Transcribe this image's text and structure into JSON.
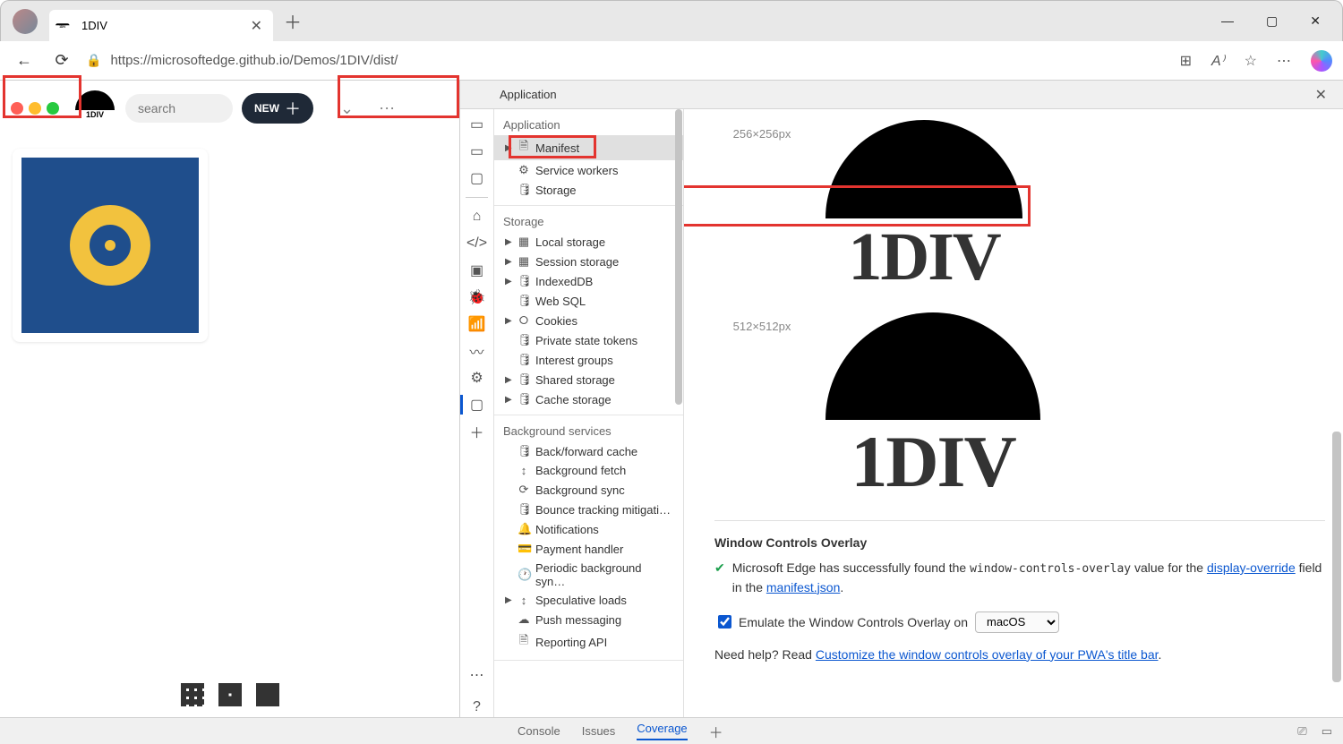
{
  "browser": {
    "tab_title": "1DIV",
    "url": "https://microsoftedge.github.io/Demos/1DIV/dist/"
  },
  "page": {
    "search_placeholder": "search",
    "new_label": "NEW",
    "logo_text": "1DIV"
  },
  "devtools": {
    "panel_title": "Application",
    "tree": {
      "application": {
        "head": "Application",
        "manifest": "Manifest",
        "service_workers": "Service workers",
        "storage_app": "Storage"
      },
      "storage": {
        "head": "Storage",
        "local": "Local storage",
        "session": "Session storage",
        "indexed": "IndexedDB",
        "websql": "Web SQL",
        "cookies": "Cookies",
        "private_tokens": "Private state tokens",
        "interest": "Interest groups",
        "shared": "Shared storage",
        "cache": "Cache storage"
      },
      "background": {
        "head": "Background services",
        "bf_cache": "Back/forward cache",
        "bg_fetch": "Background fetch",
        "bg_sync": "Background sync",
        "bounce": "Bounce tracking mitigati…",
        "notif": "Notifications",
        "payment": "Payment handler",
        "periodic": "Periodic background syn…",
        "speculative": "Speculative loads",
        "push": "Push messaging",
        "reporting": "Reporting API"
      }
    },
    "detail": {
      "dim1": "256×256px",
      "dim2": "512×512px",
      "logo_text": "1DIV",
      "wco_heading": "Window Controls Overlay",
      "wco_msg_pre": "Microsoft Edge has successfully found the ",
      "wco_val": "window-controls-overlay",
      "wco_msg_mid": " value for the ",
      "wco_link1": "display-override",
      "wco_msg_mid2": " field in the ",
      "wco_link2": "manifest.json",
      "emulate_label": "Emulate the Window Controls Overlay on",
      "emulate_value": "macOS",
      "help_pre": "Need help? Read ",
      "help_link": "Customize the window controls overlay of your PWA's title bar"
    },
    "drawer": {
      "console": "Console",
      "issues": "Issues",
      "coverage": "Coverage"
    }
  }
}
